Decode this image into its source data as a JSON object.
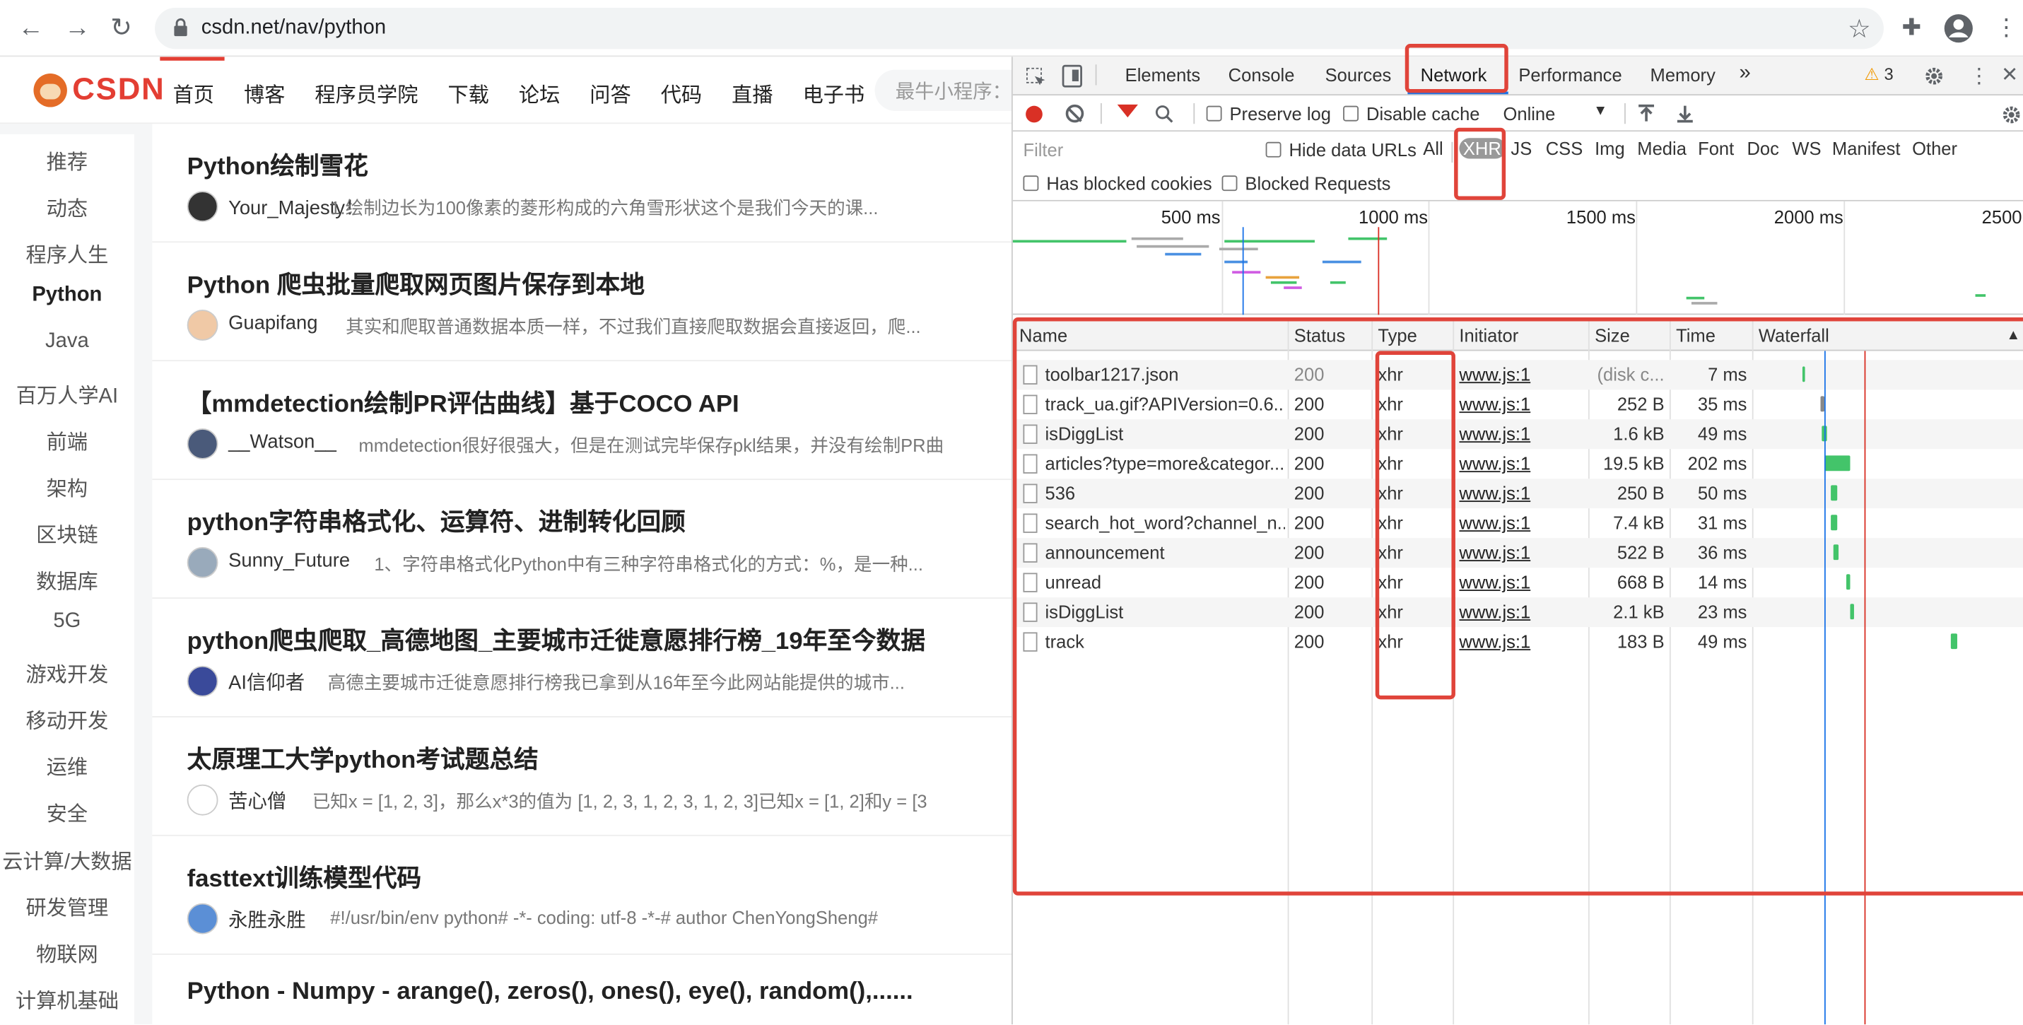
{
  "browser": {
    "url": "csdn.net/nav/python"
  },
  "csdn": {
    "logo": "CSDN",
    "nav": [
      "首页",
      "博客",
      "程序员学院",
      "下载",
      "论坛",
      "问答",
      "代码",
      "直播",
      "电子书"
    ],
    "search_placeholder": "最牛小程序：",
    "sidebar": [
      "推荐",
      "动态",
      "程序人生",
      "Python",
      "Java",
      "百万人学AI",
      "前端",
      "架构",
      "区块链",
      "数据库",
      "5G",
      "游戏开发",
      "移动开发",
      "运维",
      "安全",
      "云计算/大数据",
      "研发管理",
      "物联网",
      "计算机基础"
    ],
    "sidebar_active": "Python",
    "posts": [
      {
        "title": "Python绘制雪花",
        "author": "Your_Majesty！",
        "desc": "1.绘制边长为100像素的菱形构成的六角雪形状这个是我们今天的课..."
      },
      {
        "title": "Python 爬虫批量爬取网页图片保存到本地",
        "author": "Guapifang",
        "desc": "其实和爬取普通数据本质一样，不过我们直接爬取数据会直接返回，爬..."
      },
      {
        "title": "【mmdetection绘制PR评估曲线】基于COCO API",
        "author": "__Watson__",
        "desc": "mmdetection很好很强大，但是在测试完毕保存pkl结果，并没有绘制PR曲"
      },
      {
        "title": "python字符串格式化、运算符、进制转化回顾",
        "author": "Sunny_Future",
        "desc": "1、字符串格式化Python中有三种字符串格式化的方式：%，是一种..."
      },
      {
        "title": "python爬虫爬取_高德地图_主要城市迁徙意愿排行榜_19年至今数据",
        "author": "AI信仰者",
        "desc": "高德主要城市迁徙意愿排行榜我已拿到从16年至今此网站能提供的城市..."
      },
      {
        "title": "太原理工大学python考试题总结",
        "author": "苦心僧",
        "desc": "已知x = [1, 2, 3]，那么x*3的值为 [1, 2, 3, 1, 2, 3, 1, 2, 3]已知x = [1, 2]和y = [3"
      },
      {
        "title": "fasttext训练模型代码",
        "author": "永胜永胜",
        "desc": "#!/usr/bin/env python# -*- coding: utf-8 -*-# author ChenYongSheng#"
      },
      {
        "title": "Python - Numpy - arange(), zeros(), ones(), eye(), random(),......",
        "author": "",
        "desc": ""
      }
    ]
  },
  "devtools": {
    "tabs": [
      "Elements",
      "Console",
      "Sources",
      "Network",
      "Performance",
      "Memory"
    ],
    "more_tabs": "»",
    "selected_tab": "Network",
    "warnings": "3",
    "toolbar": {
      "preserve_log": "Preserve log",
      "disable_cache": "Disable cache",
      "throttle": "Online"
    },
    "filter": {
      "placeholder": "Filter",
      "hide_data_urls": "Hide data URLs",
      "types": [
        "All",
        "XHR",
        "JS",
        "CSS",
        "Img",
        "Media",
        "Font",
        "Doc",
        "WS",
        "Manifest",
        "Other"
      ],
      "selected_type": "XHR",
      "has_blocked_cookies": "Has blocked cookies",
      "blocked_requests": "Blocked Requests"
    },
    "overview_ticks": [
      "500 ms",
      "1000 ms",
      "1500 ms",
      "2000 ms",
      "2500"
    ],
    "columns": [
      "Name",
      "Status",
      "Type",
      "Initiator",
      "Size",
      "Time",
      "Waterfall"
    ],
    "rows": [
      {
        "name": "toolbar1217.json",
        "status": "200",
        "type": "xhr",
        "initiator": "www.js:1",
        "size": "(disk c...",
        "time": "7 ms"
      },
      {
        "name": "track_ua.gif?APIVersion=0.6....",
        "status": "200",
        "type": "xhr",
        "initiator": "www.js:1",
        "size": "252 B",
        "time": "35 ms"
      },
      {
        "name": "isDiggList",
        "status": "200",
        "type": "xhr",
        "initiator": "www.js:1",
        "size": "1.6 kB",
        "time": "49 ms"
      },
      {
        "name": "articles?type=more&categor...",
        "status": "200",
        "type": "xhr",
        "initiator": "www.js:1",
        "size": "19.5 kB",
        "time": "202 ms"
      },
      {
        "name": "536",
        "status": "200",
        "type": "xhr",
        "initiator": "www.js:1",
        "size": "250 B",
        "time": "50 ms"
      },
      {
        "name": "search_hot_word?channel_n...",
        "status": "200",
        "type": "xhr",
        "initiator": "www.js:1",
        "size": "7.4 kB",
        "time": "31 ms"
      },
      {
        "name": "announcement",
        "status": "200",
        "type": "xhr",
        "initiator": "www.js:1",
        "size": "522 B",
        "time": "36 ms"
      },
      {
        "name": "unread",
        "status": "200",
        "type": "xhr",
        "initiator": "www.js:1",
        "size": "668 B",
        "time": "14 ms"
      },
      {
        "name": "isDiggList",
        "status": "200",
        "type": "xhr",
        "initiator": "www.js:1",
        "size": "2.1 kB",
        "time": "23 ms"
      },
      {
        "name": "track",
        "status": "200",
        "type": "xhr",
        "initiator": "www.js:1",
        "size": "183 B",
        "time": "49 ms"
      }
    ],
    "colors": {
      "accent": "#1a73e8",
      "annotation": "#e0443a",
      "bar": "#43c46a"
    }
  }
}
